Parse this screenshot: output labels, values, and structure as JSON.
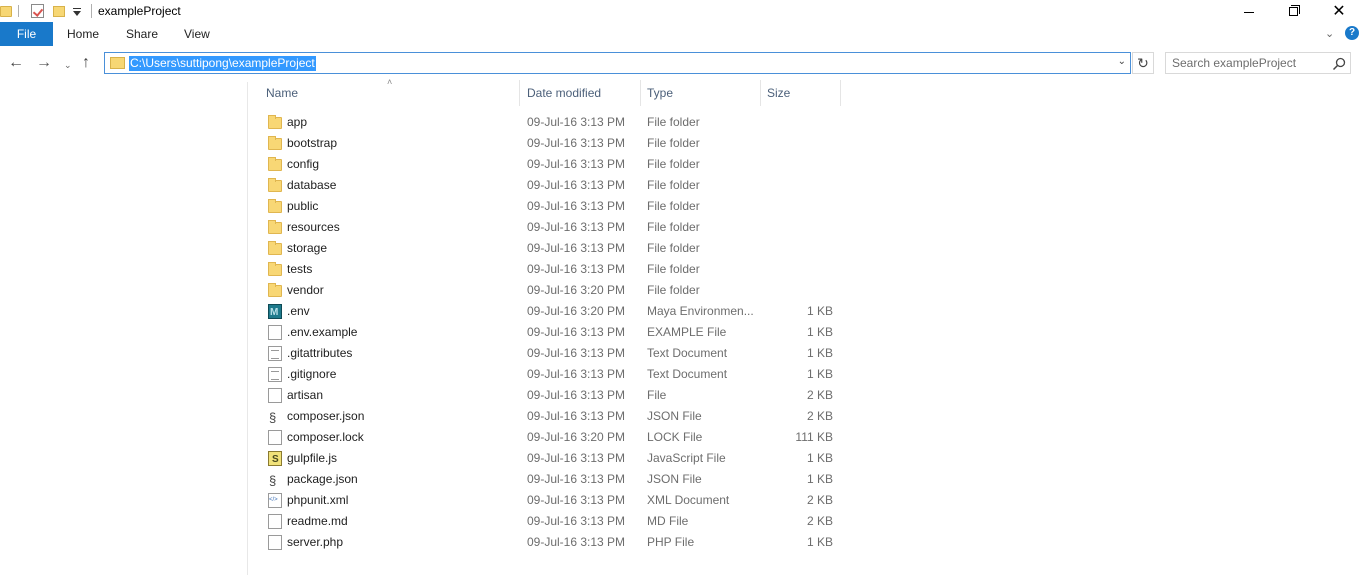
{
  "window": {
    "title": "exampleProject",
    "close_label": "✕"
  },
  "ribbon": {
    "tabs": [
      "File",
      "Home",
      "Share",
      "View"
    ]
  },
  "address_bar": {
    "path": "C:\\Users\\suttipong\\exampleProject"
  },
  "search": {
    "placeholder": "Search exampleProject"
  },
  "columns": {
    "name": "Name",
    "date": "Date modified",
    "type": "Type",
    "size": "Size"
  },
  "files": [
    {
      "name": "app",
      "date": "09-Jul-16 3:13 PM",
      "type": "File folder",
      "size": "",
      "icon": "folder"
    },
    {
      "name": "bootstrap",
      "date": "09-Jul-16 3:13 PM",
      "type": "File folder",
      "size": "",
      "icon": "folder"
    },
    {
      "name": "config",
      "date": "09-Jul-16 3:13 PM",
      "type": "File folder",
      "size": "",
      "icon": "folder"
    },
    {
      "name": "database",
      "date": "09-Jul-16 3:13 PM",
      "type": "File folder",
      "size": "",
      "icon": "folder"
    },
    {
      "name": "public",
      "date": "09-Jul-16 3:13 PM",
      "type": "File folder",
      "size": "",
      "icon": "folder"
    },
    {
      "name": "resources",
      "date": "09-Jul-16 3:13 PM",
      "type": "File folder",
      "size": "",
      "icon": "folder"
    },
    {
      "name": "storage",
      "date": "09-Jul-16 3:13 PM",
      "type": "File folder",
      "size": "",
      "icon": "folder"
    },
    {
      "name": "tests",
      "date": "09-Jul-16 3:13 PM",
      "type": "File folder",
      "size": "",
      "icon": "folder"
    },
    {
      "name": "vendor",
      "date": "09-Jul-16 3:20 PM",
      "type": "File folder",
      "size": "",
      "icon": "folder"
    },
    {
      "name": ".env",
      "date": "09-Jul-16 3:20 PM",
      "type": "Maya Environmen...",
      "size": "1 KB",
      "icon": "maya"
    },
    {
      "name": ".env.example",
      "date": "09-Jul-16 3:13 PM",
      "type": "EXAMPLE File",
      "size": "1 KB",
      "icon": "file"
    },
    {
      "name": ".gitattributes",
      "date": "09-Jul-16 3:13 PM",
      "type": "Text Document",
      "size": "1 KB",
      "icon": "text"
    },
    {
      "name": ".gitignore",
      "date": "09-Jul-16 3:13 PM",
      "type": "Text Document",
      "size": "1 KB",
      "icon": "text"
    },
    {
      "name": "artisan",
      "date": "09-Jul-16 3:13 PM",
      "type": "File",
      "size": "2 KB",
      "icon": "file"
    },
    {
      "name": "composer.json",
      "date": "09-Jul-16 3:13 PM",
      "type": "JSON File",
      "size": "2 KB",
      "icon": "json"
    },
    {
      "name": "composer.lock",
      "date": "09-Jul-16 3:20 PM",
      "type": "LOCK File",
      "size": "111 KB",
      "icon": "file"
    },
    {
      "name": "gulpfile.js",
      "date": "09-Jul-16 3:13 PM",
      "type": "JavaScript File",
      "size": "1 KB",
      "icon": "js"
    },
    {
      "name": "package.json",
      "date": "09-Jul-16 3:13 PM",
      "type": "JSON File",
      "size": "1 KB",
      "icon": "json"
    },
    {
      "name": "phpunit.xml",
      "date": "09-Jul-16 3:13 PM",
      "type": "XML Document",
      "size": "2 KB",
      "icon": "xml"
    },
    {
      "name": "readme.md",
      "date": "09-Jul-16 3:13 PM",
      "type": "MD File",
      "size": "2 KB",
      "icon": "file"
    },
    {
      "name": "server.php",
      "date": "09-Jul-16 3:13 PM",
      "type": "PHP File",
      "size": "1 KB",
      "icon": "file"
    }
  ]
}
